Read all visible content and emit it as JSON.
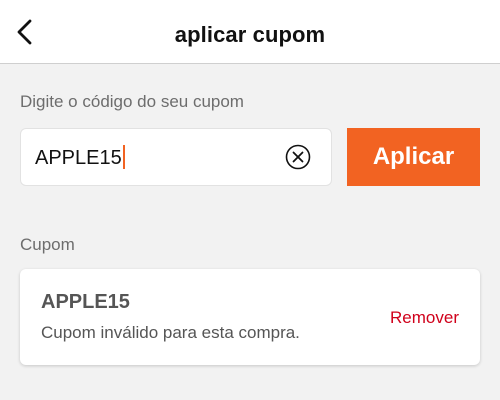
{
  "header": {
    "title": "aplicar cupom",
    "back_icon": "chevron-left-icon"
  },
  "form": {
    "label": "Digite o código do seu cupom",
    "input_value": "APPLE15",
    "clear_icon": "clear-circle-x-icon",
    "apply_label": "Aplicar"
  },
  "coupon_section": {
    "label": "Cupom",
    "code": "APPLE15",
    "message": "Cupom inválido para esta compra.",
    "remove_label": "Remover"
  },
  "colors": {
    "accent": "#f26322",
    "error": "#d0011b",
    "background": "#f2f2f2"
  }
}
